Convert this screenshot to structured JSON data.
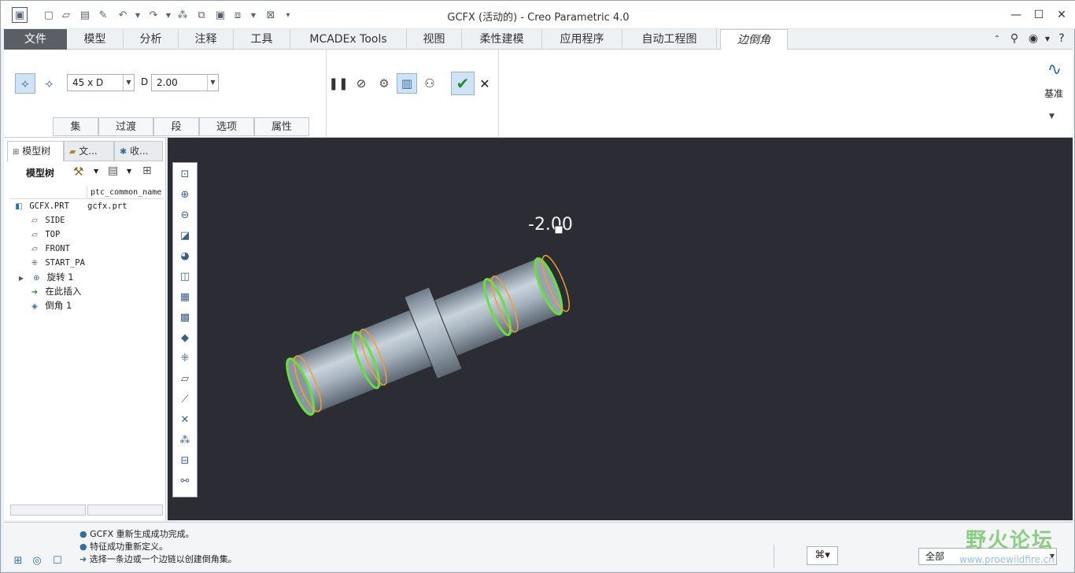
{
  "window": {
    "title": "GCFX (活动的) - Creo Parametric 4.0"
  },
  "tabs": [
    {
      "label": "文件"
    },
    {
      "label": "模型"
    },
    {
      "label": "分析"
    },
    {
      "label": "注释"
    },
    {
      "label": "工具"
    },
    {
      "label": "MCADEx Tools"
    },
    {
      "label": "视图"
    },
    {
      "label": "柔性建模"
    },
    {
      "label": "应用程序"
    },
    {
      "label": "自动工程图"
    },
    {
      "label": "边倒角"
    }
  ],
  "ribbon": {
    "dim_scheme": "45 x D",
    "d_label": "D",
    "d_value": "2.00",
    "datum_label": "基准",
    "subtabs": [
      "集",
      "过渡",
      "段",
      "选项",
      "属性"
    ]
  },
  "left_panel": {
    "tabs": [
      "模型树",
      "文...",
      "收..."
    ],
    "tree_label": "模型树",
    "column_header": "ptc_common_name",
    "items": [
      {
        "label": "GCFX.PRT",
        "value": "gcfx.prt"
      },
      {
        "label": "SIDE"
      },
      {
        "label": "TOP"
      },
      {
        "label": "FRONT"
      },
      {
        "label": "START_PA"
      },
      {
        "label": "旋转 1"
      },
      {
        "label": "在此插入"
      },
      {
        "label": "倒角 1"
      }
    ]
  },
  "viewport": {
    "dimension_label": "-2.00"
  },
  "status": {
    "messages": [
      "GCFX 重新生成成功完成。",
      "特征成功重新定义。",
      "选择一条边或一个边链以创建倒角集。"
    ],
    "filter": "全部"
  },
  "watermark": {
    "title": "野火论坛",
    "url": "www.proewildfire.cn"
  }
}
